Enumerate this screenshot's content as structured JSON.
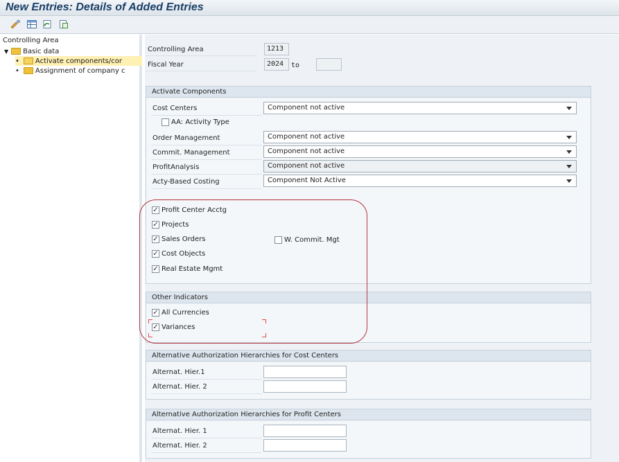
{
  "window": {
    "title": "New Entries: Details of Added Entries"
  },
  "toolbar": {
    "icons": [
      "display-change-icon",
      "table-icon",
      "undo-icon",
      "copy-icon"
    ]
  },
  "tree": {
    "header": "Controlling Area",
    "items": [
      {
        "label": "Basic data",
        "level": 0,
        "expanded": true
      },
      {
        "label": "Activate components/cor",
        "level": 1,
        "selected": true
      },
      {
        "label": "Assignment of company c",
        "level": 1,
        "selected": false
      }
    ]
  },
  "header_fields": {
    "controlling_area_label": "Controlling Area",
    "controlling_area_value": "1213",
    "fiscal_year_label": "Fiscal Year",
    "fiscal_year_value": "2024",
    "to_label": "to",
    "fiscal_year_to_value": ""
  },
  "activate_components": {
    "title": "Activate Components",
    "rows": [
      {
        "label": "Cost Centers",
        "value": "Component not active"
      },
      {
        "label": "Order Management",
        "value": "Component not active"
      },
      {
        "label": "Commit. Management",
        "value": "Component not active"
      },
      {
        "label": "ProfitAnalysis",
        "value": "Component not active"
      },
      {
        "label": "Acty-Based Costing",
        "value": "Component Not Active"
      }
    ],
    "aa_activity_type": {
      "label": "AA: Activity Type",
      "checked": false
    },
    "checkboxes": [
      {
        "label": "Profit Center Acctg",
        "checked": true
      },
      {
        "label": "Projects",
        "checked": true
      },
      {
        "label": "Sales Orders",
        "checked": true
      },
      {
        "label": "Cost Objects",
        "checked": true
      },
      {
        "label": "Real Estate Mgmt",
        "checked": true
      }
    ],
    "w_commit_mgt": {
      "label": "W. Commit. Mgt",
      "checked": false
    }
  },
  "other_indicators": {
    "title": "Other Indicators",
    "checkboxes": [
      {
        "label": "All Currencies",
        "checked": true
      },
      {
        "label": "Variances",
        "checked": true
      }
    ]
  },
  "alt_auth_cost": {
    "title": "Alternative Authorization Hierarchies for Cost Centers",
    "rows": [
      {
        "label": "Alternat. Hier.1",
        "value": ""
      },
      {
        "label": "Alternat. Hier. 2",
        "value": ""
      }
    ]
  },
  "alt_auth_profit": {
    "title": "Alternative Authorization Hierarchies for Profit Centers",
    "rows": [
      {
        "label": "Alternat. Hier. 1",
        "value": ""
      },
      {
        "label": "Alternat. Hier. 2",
        "value": ""
      }
    ]
  },
  "colors": {
    "title_text": "#1b3f66",
    "highlight_oval": "#b3323b",
    "selection": "#fff0b3",
    "folder": "#f0c23b"
  }
}
